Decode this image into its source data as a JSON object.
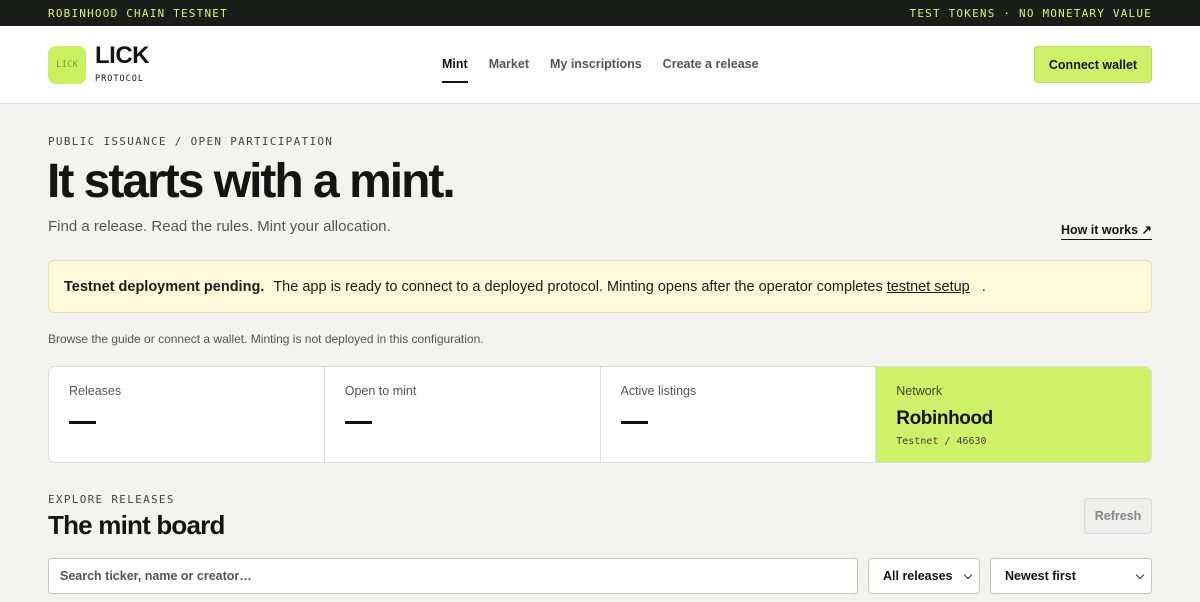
{
  "topbar": {
    "left": "ROBINHOOD CHAIN TESTNET",
    "right": "TEST TOKENS · NO MONETARY VALUE"
  },
  "brand": {
    "mark": "LICK",
    "name": "LICK",
    "sub": "PROTOCOL"
  },
  "nav": {
    "items": [
      {
        "label": "Mint",
        "active": true
      },
      {
        "label": "Market"
      },
      {
        "label": "My inscriptions"
      },
      {
        "label": "Create a release"
      }
    ]
  },
  "header": {
    "connect_label": "Connect wallet"
  },
  "hero": {
    "eyebrow": "PUBLIC ISSUANCE / OPEN PARTICIPATION",
    "title": "It starts with a mint.",
    "subtitle": "Find a release. Read the rules. Mint your allocation.",
    "how_link": "How it works ↗"
  },
  "notice": {
    "title": "Testnet deployment pending.",
    "text": "The app is ready to connect to a deployed protocol. Minting opens after the operator completes",
    "link": "testnet setup",
    "end": "."
  },
  "browse_note": "Browse the guide or connect a wallet. Minting is not deployed in this configuration.",
  "stats": {
    "releases": {
      "label": "Releases",
      "value": "—"
    },
    "open": {
      "label": "Open to mint",
      "value": "—"
    },
    "listings": {
      "label": "Active listings",
      "value": "—"
    },
    "network": {
      "label": "Network",
      "name": "Robinhood",
      "sub": "Testnet / 46630"
    }
  },
  "board": {
    "eyebrow": "EXPLORE RELEASES",
    "title": "The mint board",
    "refresh": "Refresh",
    "search_placeholder": "Search ticker, name or creator…",
    "filter_selected": "All releases",
    "sort_selected": "Newest first"
  }
}
